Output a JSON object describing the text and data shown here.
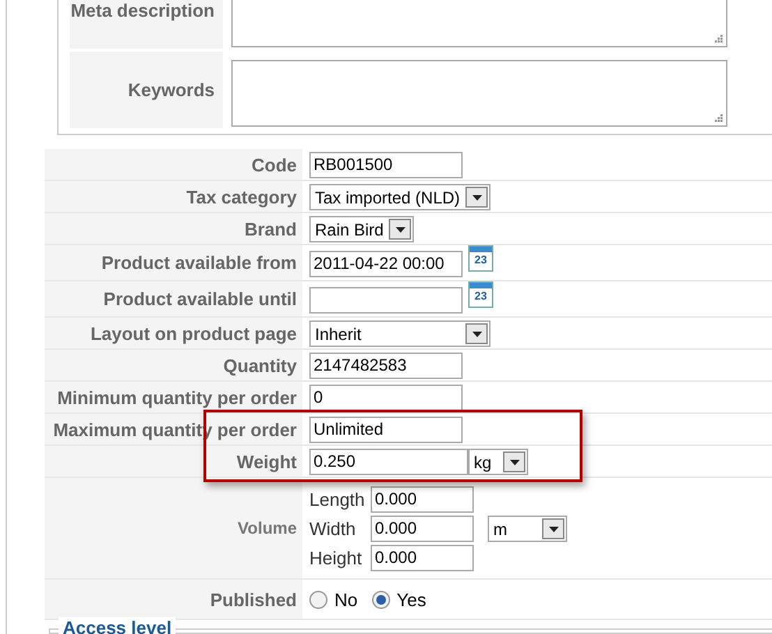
{
  "meta_fields": [
    {
      "label": "Meta description"
    },
    {
      "label": "Keywords"
    }
  ],
  "fields": [
    {
      "kind": "text",
      "label": "Code",
      "value": "RB001500"
    },
    {
      "kind": "select",
      "label": "Tax category",
      "value": "Tax imported (NLD)"
    },
    {
      "kind": "select",
      "label": "Brand",
      "value": "Rain Bird"
    },
    {
      "kind": "date",
      "label": "Product available from",
      "value": "2011-04-22 00:00",
      "icon_text": "23"
    },
    {
      "kind": "date",
      "label": "Product available until",
      "icon_text": "23"
    },
    {
      "kind": "wideselect",
      "label": "Layout on product page",
      "value": "Inherit"
    },
    {
      "kind": "text",
      "label": "Quantity",
      "value": "2147482583"
    },
    {
      "kind": "text",
      "label": "Minimum quantity per order",
      "value": "0"
    },
    {
      "kind": "text",
      "label": "Maximum quantity per order",
      "value": "Unlimited"
    },
    {
      "kind": "unit",
      "label": "Weight",
      "value": "0.250",
      "unit": "kg"
    },
    {
      "kind": "volume",
      "label": "Volume",
      "unit": "m",
      "dims": [
        {
          "label": "Length",
          "value": "0.000"
        },
        {
          "label": "Width",
          "value": "0.000"
        },
        {
          "label": "Height",
          "value": "0.000"
        }
      ]
    },
    {
      "kind": "radio",
      "label": "Published",
      "options": [
        {
          "label": "No",
          "selected": false
        },
        {
          "label": "Yes",
          "selected": true
        }
      ]
    }
  ],
  "access_section": {
    "title": "Access level"
  }
}
